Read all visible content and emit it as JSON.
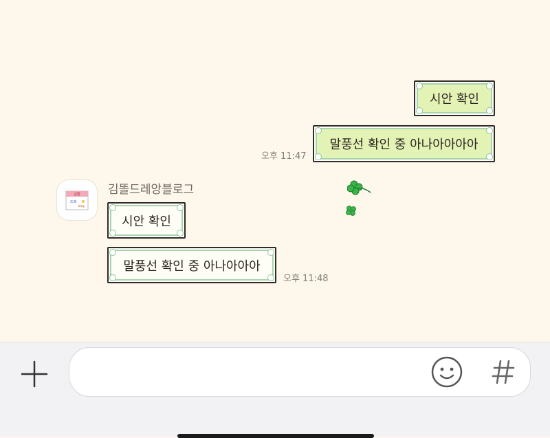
{
  "messages": {
    "outgoing": [
      {
        "text": "시안 확인"
      },
      {
        "text": "말풍선 확인 중 아나아아아아"
      }
    ],
    "outgoing_time": "오후 11:47",
    "incoming_sender": "김똘드레앙블로그",
    "incoming": [
      {
        "text": "시안 확인"
      },
      {
        "text": "말풍선 확인 중 아나아아아"
      }
    ],
    "incoming_time": "오후 11:48"
  },
  "input_bar": {
    "plus_icon": "plus-icon",
    "emoji_icon": "smiley-icon",
    "hash_icon": "hash-icon",
    "placeholder": ""
  },
  "colors": {
    "background": "#fdf7ec",
    "outgoing_bubble": "#e3f2b5",
    "incoming_bubble": "#fffef6",
    "bubble_border": "#2f2a26",
    "bubble_inner_line": "#a7d3ad",
    "clover": "#39b54a",
    "input_bar": "#f2f1f3"
  }
}
